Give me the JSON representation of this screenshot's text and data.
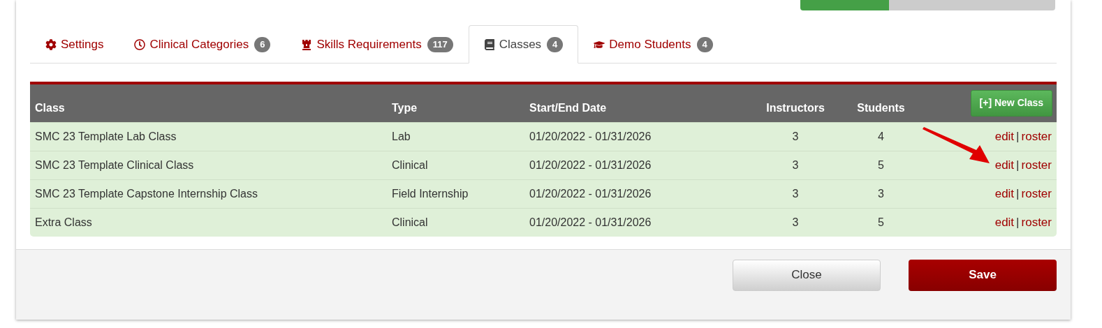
{
  "tabs": [
    {
      "label": "Settings",
      "selected": false
    },
    {
      "label": "Clinical Categories",
      "badge": "6",
      "selected": false
    },
    {
      "label": "Skills Requirements",
      "badge": "117",
      "selected": false
    },
    {
      "label": "Classes",
      "badge": "4",
      "selected": true
    },
    {
      "label": "Demo Students",
      "badge": "4",
      "selected": false
    }
  ],
  "table": {
    "columns": [
      "Class",
      "Type",
      "Start/End Date",
      "Instructors",
      "Students"
    ],
    "new_button": "[+] New Class",
    "rows": [
      {
        "class": "SMC 23 Template Lab Class",
        "type": "Lab",
        "dates": "01/20/2022 - 01/31/2026",
        "instructors": "3",
        "students": "4",
        "edit": "edit",
        "separator": "|",
        "roster": "roster"
      },
      {
        "class": "SMC 23 Template Clinical Class",
        "type": "Clinical",
        "dates": "01/20/2022 - 01/31/2026",
        "instructors": "3",
        "students": "5",
        "edit": "edit",
        "separator": "|",
        "roster": "roster"
      },
      {
        "class": "SMC 23 Template Capstone Internship Class",
        "type": "Field Internship",
        "dates": "01/20/2022 - 01/31/2026",
        "instructors": "3",
        "students": "3",
        "edit": "edit",
        "separator": "|",
        "roster": "roster"
      },
      {
        "class": "Extra Class",
        "type": "Clinical",
        "dates": "01/20/2022 - 01/31/2026",
        "instructors": "3",
        "students": "5",
        "edit": "edit",
        "separator": "|",
        "roster": "roster"
      }
    ]
  },
  "footer": {
    "buttons": [
      {
        "label": "Close",
        "kind": "secondary"
      },
      {
        "label": "Save",
        "kind": "primary"
      }
    ]
  }
}
